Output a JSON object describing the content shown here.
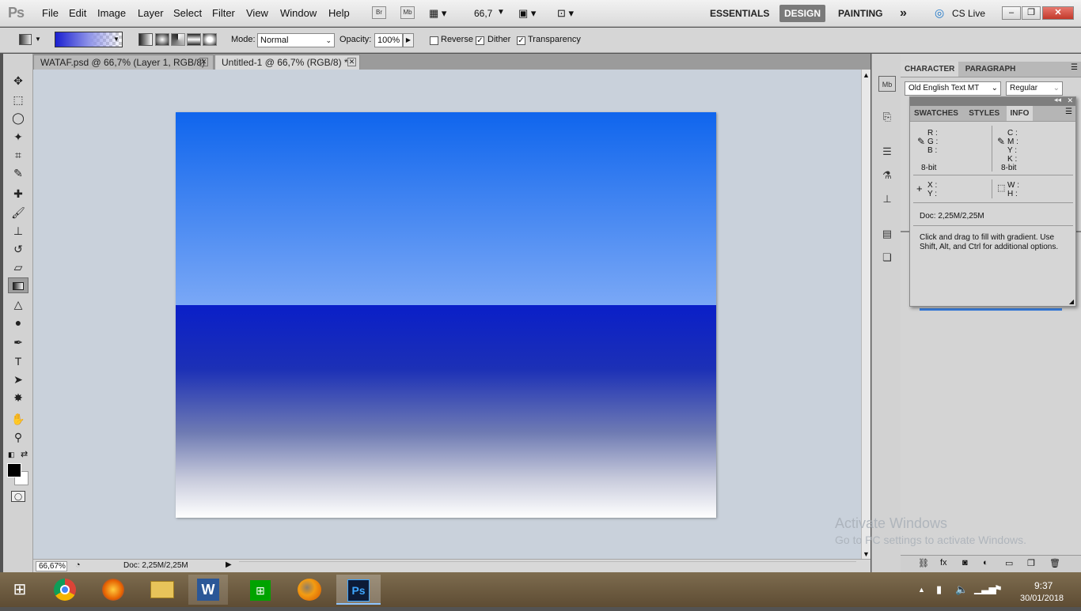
{
  "app": {
    "logo": "Ps"
  },
  "menu": [
    "File",
    "Edit",
    "Image",
    "Layer",
    "Select",
    "Filter",
    "View",
    "Window",
    "Help"
  ],
  "appbar": {
    "bridge": "Br",
    "minibridge": "Mb",
    "zoom": "66,7"
  },
  "workspaces": {
    "essentials": "ESSENTIALS",
    "design": "DESIGN",
    "painting": "PAINTING",
    "more": "»"
  },
  "cslive": "CS Live",
  "options": {
    "mode_label": "Mode:",
    "mode_value": "Normal",
    "opacity_label": "Opacity:",
    "opacity_value": "100%",
    "reverse": "Reverse",
    "dither": "Dither",
    "transparency": "Transparency",
    "reverse_checked": false,
    "dither_checked": true,
    "transparency_checked": true
  },
  "tabs": [
    {
      "label": "WATAF.psd @ 66,7% (Layer 1, RGB/8)",
      "active": false
    },
    {
      "label": "Untitled-1 @ 66,7% (RGB/8) *",
      "active": true
    }
  ],
  "status": {
    "zoom": "66,67%",
    "doc": "Doc: 2,25M/2,25M"
  },
  "character_panel": {
    "tabs": [
      "CHARACTER",
      "PARAGRAPH"
    ],
    "font": "Old English Text MT",
    "style": "Regular"
  },
  "info_panel": {
    "tabs": [
      "SWATCHES",
      "STYLES",
      "INFO"
    ],
    "rgb": [
      "R :",
      "G :",
      "B :"
    ],
    "cmyk": [
      "C :",
      "M :",
      "Y :",
      "K :"
    ],
    "bitdepth_left": "8-bit",
    "bitdepth_right": "8-bit",
    "xy": [
      "X :",
      "Y :"
    ],
    "wh": [
      "W :",
      "H :"
    ],
    "doc": "Doc: 2,25M/2,25M",
    "hint": "Click and drag to fill with gradient.  Use Shift, Alt, and Ctrl for additional options."
  },
  "watermark": {
    "line1": "Activate Windows",
    "line2": "Go to PC settings to activate Windows."
  },
  "taskbar": {
    "time": "9:37",
    "date": "30/01/2018",
    "active": "Ps"
  },
  "colors": {
    "gradient_top_start": "#0f65ed",
    "gradient_top_end": "#7aa8f6",
    "gradient_bottom_start": "#0a1fc8",
    "gradient_bottom_end": "#ffffff"
  }
}
